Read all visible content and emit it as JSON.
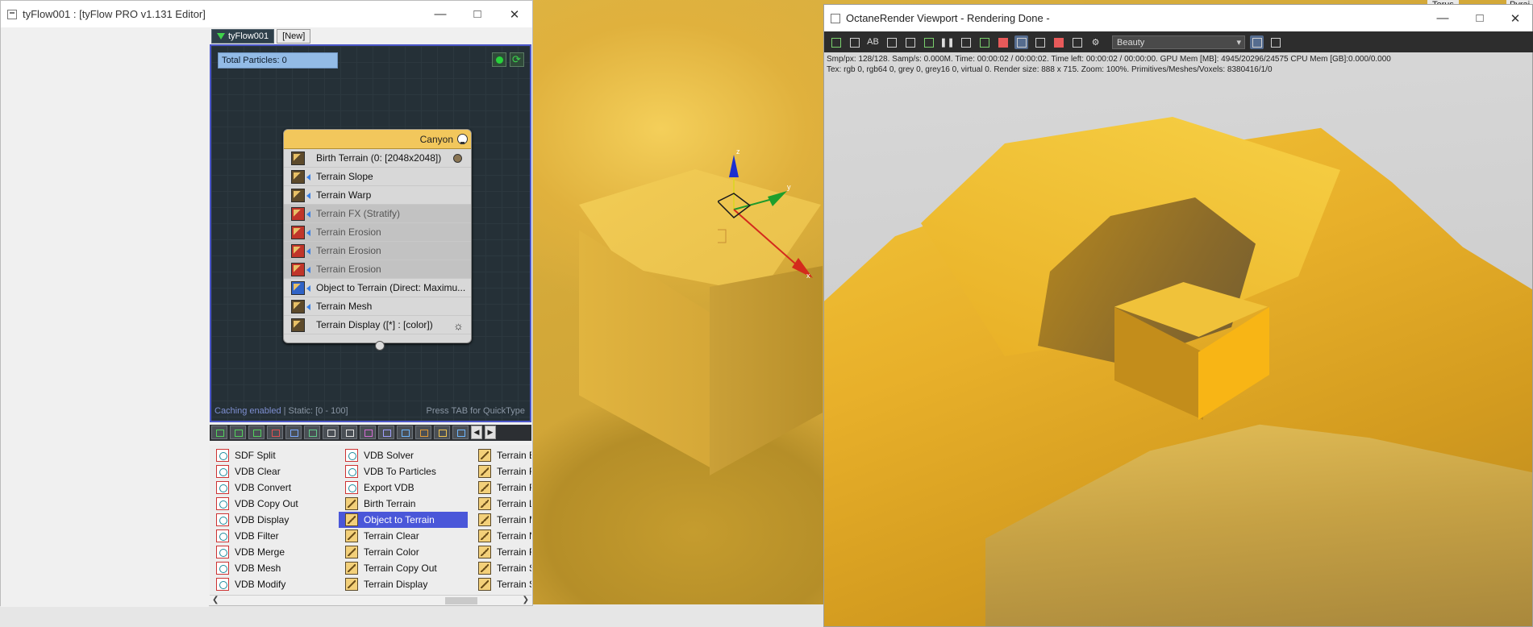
{
  "background": {
    "corner_labels": [
      "Torus",
      "Pyrai"
    ]
  },
  "tyflow_window": {
    "title": "tyFlow001 : [tyFlow PRO v1.131 Editor]",
    "tabs": [
      {
        "label": "tyFlow001"
      },
      {
        "label": "[New]"
      }
    ],
    "total_particles": "Total Particles: 0",
    "node": {
      "title": "Canyon",
      "operators": [
        {
          "label": "Birth Terrain (0: [2048x2048])",
          "disabled": false
        },
        {
          "label": "Terrain Slope",
          "disabled": false
        },
        {
          "label": "Terrain Warp",
          "disabled": false
        },
        {
          "label": "Terrain FX (Stratify)",
          "disabled": true
        },
        {
          "label": "Terrain Erosion",
          "disabled": true
        },
        {
          "label": "Terrain Erosion",
          "disabled": true
        },
        {
          "label": "Terrain Erosion",
          "disabled": true
        },
        {
          "label": "Object to Terrain (Direct: Maximu...",
          "disabled": false
        },
        {
          "label": "Terrain Mesh",
          "disabled": false
        },
        {
          "label": "Terrain Display ([*] : [color])",
          "disabled": false
        }
      ]
    },
    "status_caching": "Caching enabled",
    "status_static": " | Static: [0 - 100]",
    "tab_hint": "Press TAB for QuickType",
    "operator_list": {
      "col1": [
        "SDF Split",
        "VDB Clear",
        "VDB Convert",
        "VDB Copy Out",
        "VDB Display",
        "VDB Filter",
        "VDB Merge",
        "VDB Mesh",
        "VDB Modify"
      ],
      "col2": [
        "VDB Solver",
        "VDB To Particles",
        "Export VDB",
        "Birth Terrain",
        "Object to Terrain",
        "Terrain Clear",
        "Terrain Color",
        "Terrain Copy Out",
        "Terrain Display"
      ],
      "col3": [
        "Terrain E",
        "Terrain F",
        "Terrain F",
        "Terrain L",
        "Terrain M",
        "Terrain N",
        "Terrain F",
        "Terrain S",
        "Terrain S"
      ],
      "selected": "Object to Terrain"
    }
  },
  "octane_window": {
    "title": "OctaneRender Viewport - Rendering Done -",
    "pass_select": "Beauty",
    "info_line1": "Smp/px: 128/128.   Samp/s: 0.000M.   Time: 00:00:02 / 00:00:02.   Time left: 00:00:02 / 00:00:00.   GPU Mem [MB]: 4945/20296/24575   CPU Mem [GB]:0.000/0.000",
    "info_line2": "Tex: rgb 0, rgb64 0, grey 0, grey16 0, virtual 0.   Render size: 888 x 715.   Zoom: 100%.   Primitives/Meshes/Voxels: 8380416/1/0"
  },
  "colors": {
    "terrain_yellow": "#f2c232",
    "graph_bg": "#253037",
    "selection_blue": "#4a57d9",
    "node_header": "#f2c75c"
  }
}
